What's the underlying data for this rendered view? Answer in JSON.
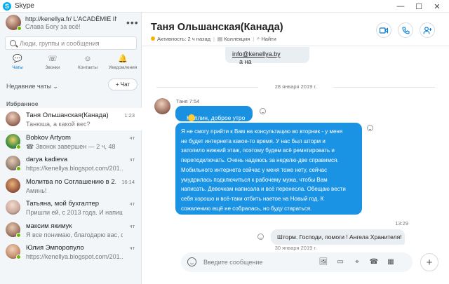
{
  "window": {
    "title": "Skype",
    "minimize": "—",
    "maximize": "☐",
    "close": "✕"
  },
  "profile": {
    "name": "http://kenellya.fr/ L'ACADÉMIE INTER...",
    "mood": "Слава Богу за всё!",
    "more": "•••"
  },
  "search": {
    "placeholder": "Люди, группы и сообщения"
  },
  "nav": [
    {
      "label": "Чаты",
      "icon": "chat-icon",
      "glyph": "💬"
    },
    {
      "label": "Звонки",
      "icon": "phone-icon",
      "glyph": "☏"
    },
    {
      "label": "Контакты",
      "icon": "contacts-icon",
      "glyph": "☺"
    },
    {
      "label": "Уведомления",
      "icon": "bell-icon",
      "glyph": "🔔"
    }
  ],
  "recent_header": "Недавние чаты ⌄",
  "new_chat": "+ Чат",
  "favorites_header": "Избранное",
  "chats": [
    {
      "name": "Таня Ольшанская(Канада)",
      "preview": "Танюша, а какой вес?",
      "time": "1:23",
      "avatar_color": "#b9868a"
    },
    {
      "name": "Bobkov Artyom",
      "preview": "☎ Звонок завершен — 2 ч, 48",
      "time": "чт",
      "avatar_color": "#3f8f3f"
    },
    {
      "name": "darya kadieva",
      "preview": "https://kenellya.blogspot.com/201...",
      "time": "чт",
      "avatar_color": "#8c7a6a"
    },
    {
      "name": "Молитва по Соглашению в 2...",
      "preview": "Аминь!",
      "time": "16:14",
      "avatar_color": "#9c5b40"
    },
    {
      "name": "Татьяна, мой бухгалтер",
      "preview": "Пришли ей, с 2013 года. И напиш...",
      "time": "чт",
      "avatar_color": "#c9a79b"
    },
    {
      "name": "максим якимук",
      "preview": "Я все понимаю, благодарю вас, о...",
      "time": "чт",
      "avatar_color": "#a07a68"
    },
    {
      "name": "Юлия Эмпоропуло",
      "preview": "https://kenellya.blogspot.com/201...",
      "time": "чт",
      "avatar_color": "#c68f6e"
    }
  ],
  "header": {
    "contact_name": "Таня Ольшанская(Канада)",
    "activity": "Активность: 2 ч назад",
    "collection": "Коллекция",
    "find": "Найти",
    "buttons": [
      "video-call",
      "audio-call",
      "add-person"
    ]
  },
  "messages": {
    "top_fragment_prefix": "а на ",
    "top_fragment_link": "info@kenellya.by",
    "date_1": "28 января 2019 г.",
    "sender_meta": "Таня 7:54",
    "greeting": "Неллин, доброе утро",
    "long_text": "Я не смогу прийти к Вам на консультацию во вторник - у меня\nне будет интернета какое-то время. У нас был шторм и\nзатопило нижний этаж, поэтому будем всё ремнтировать и\nпереподключать. Очень надеюсь за неделю-две справимся.\nМобильного интернета сейчас у меня тоже нету, сейчас\nумудрилась подключиться к рабочему мужа, чтобы Вам\nнаписать. Девочкам написала и всё перенесла. Обещаю вести\nсебя хорошо и всё-таки отбить наетое на Новый год. К\nсожалению ещё не собралась, но буду стараться.",
    "out_time": "13:29",
    "out_text": "Шторм. Господи, помоги ! Ангела Хранителя!",
    "date_2": "30 января 2019 г."
  },
  "composer": {
    "placeholder": "Введите сообщение",
    "tools": [
      "🖼",
      "▭",
      "⌖",
      "☎",
      "▦"
    ]
  }
}
